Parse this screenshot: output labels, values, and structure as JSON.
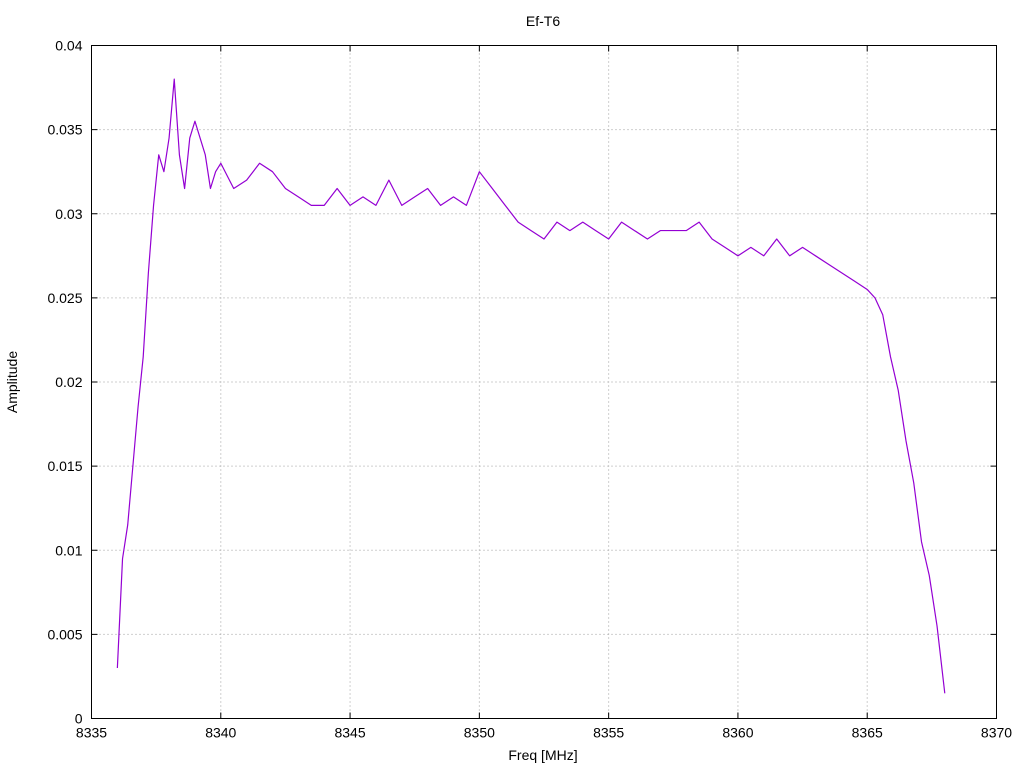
{
  "chart_data": {
    "type": "line",
    "title": "Ef-T6",
    "xlabel": "Freq [MHz]",
    "ylabel": "Amplitude",
    "xlim": [
      8335,
      8370
    ],
    "ylim": [
      0,
      0.04
    ],
    "x_ticks": [
      "8335",
      "8340",
      "8345",
      "8350",
      "8355",
      "8360",
      "8365",
      "8370"
    ],
    "y_ticks": [
      "0",
      "0.005",
      "0.01",
      "0.015",
      "0.02",
      "0.025",
      "0.03",
      "0.035",
      "0.04"
    ],
    "grid": true,
    "legend": "none",
    "series": [
      {
        "color": "#9400d3",
        "x": [
          8336.0,
          8336.2,
          8336.4,
          8336.6,
          8336.8,
          8337.0,
          8337.2,
          8337.4,
          8337.6,
          8337.8,
          8338.0,
          8338.2,
          8338.4,
          8338.6,
          8338.8,
          8339.0,
          8339.2,
          8339.4,
          8339.6,
          8339.8,
          8340.0,
          8340.5,
          8341.0,
          8341.5,
          8342.0,
          8342.5,
          8343.0,
          8343.5,
          8344.0,
          8344.5,
          8345.0,
          8345.5,
          8346.0,
          8346.5,
          8347.0,
          8347.5,
          8348.0,
          8348.5,
          8349.0,
          8349.5,
          8350.0,
          8350.5,
          8351.0,
          8351.5,
          8352.0,
          8352.5,
          8353.0,
          8353.5,
          8354.0,
          8354.5,
          8355.0,
          8355.5,
          8356.0,
          8356.5,
          8357.0,
          8357.5,
          8358.0,
          8358.5,
          8359.0,
          8359.5,
          8360.0,
          8360.5,
          8361.0,
          8361.5,
          8362.0,
          8362.5,
          8363.0,
          8363.5,
          8364.0,
          8364.5,
          8365.0,
          8365.3,
          8365.6,
          8365.9,
          8366.2,
          8366.5,
          8366.8,
          8367.1,
          8367.4,
          8367.7,
          8368.0
        ],
        "y": [
          0.003,
          0.0095,
          0.0115,
          0.015,
          0.0185,
          0.0215,
          0.0265,
          0.0305,
          0.0335,
          0.0325,
          0.0345,
          0.038,
          0.0335,
          0.0315,
          0.0345,
          0.0355,
          0.0345,
          0.0335,
          0.0315,
          0.0325,
          0.033,
          0.0315,
          0.032,
          0.033,
          0.0325,
          0.0315,
          0.031,
          0.0305,
          0.0305,
          0.0315,
          0.0305,
          0.031,
          0.0305,
          0.032,
          0.0305,
          0.031,
          0.0315,
          0.0305,
          0.031,
          0.0305,
          0.0325,
          0.0315,
          0.0305,
          0.0295,
          0.029,
          0.0285,
          0.0295,
          0.029,
          0.0295,
          0.029,
          0.0285,
          0.0295,
          0.029,
          0.0285,
          0.029,
          0.029,
          0.029,
          0.0295,
          0.0285,
          0.028,
          0.0275,
          0.028,
          0.0275,
          0.0285,
          0.0275,
          0.028,
          0.0275,
          0.027,
          0.0265,
          0.026,
          0.0255,
          0.025,
          0.024,
          0.0215,
          0.0195,
          0.0165,
          0.014,
          0.0105,
          0.0085,
          0.0055,
          0.0015
        ]
      }
    ]
  }
}
